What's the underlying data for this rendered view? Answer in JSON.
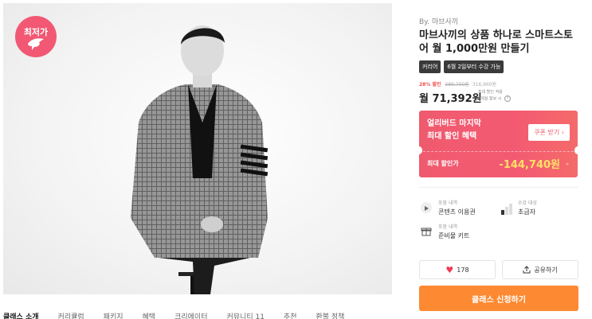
{
  "hero": {
    "badge_label": "최저가"
  },
  "tabs": [
    "클래스 소개",
    "커리큘럼",
    "패키지",
    "혜택",
    "크리에이터",
    "커뮤니티 11",
    "추천",
    "환불 정책"
  ],
  "product": {
    "by": "By. 마브사끼",
    "title": "마브사끼의 상품 하나로 스마트스토어 월 1,000만원 만들기",
    "tags": [
      "커리어",
      "6월 2일부터 수강 가능"
    ],
    "discount_pct": "28% 할인",
    "original_price": "389,700원",
    "sale_price_total": "316,960원",
    "monthly_price": "월 71,392원",
    "price_note_1": "최대 할인 적용",
    "price_note_2": "5개월 할부 시",
    "info_icon": "?"
  },
  "promo": {
    "line1": "얼리버드 마지막",
    "line2": "최대 할인 혜택",
    "coupon_button": "쿠폰 받기",
    "coupon_chevron": "›",
    "max_label": "최대 할인가",
    "max_value": "-144,740원",
    "max_chevron": "⌄"
  },
  "includes": {
    "content_caption": "포함 내역",
    "content_value": "콘텐츠 이용권",
    "level_caption": "수강 대상",
    "level_value": "초급자",
    "kit_caption": "포함 내역",
    "kit_value": "준비물 키트"
  },
  "actions": {
    "like_count": "178",
    "share_label": "공유하기",
    "cta_label": "클래스 신청하기"
  },
  "colors": {
    "badge": "#f25873",
    "promo": "#f05a6e",
    "cta": "#fd8a32",
    "max_value": "#ffe066"
  }
}
